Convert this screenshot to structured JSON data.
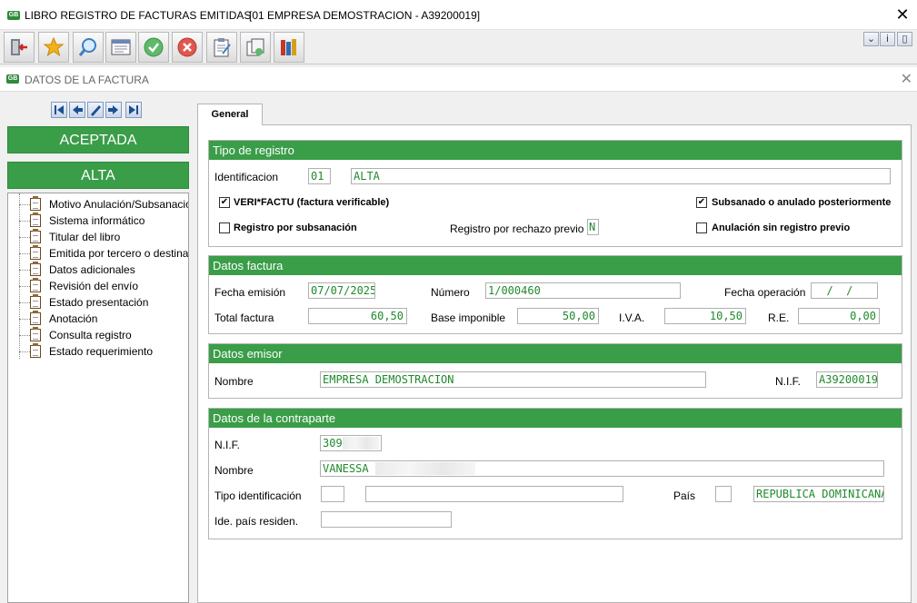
{
  "window": {
    "title": "LIBRO REGISTRO DE FACTURAS EMITIDAS",
    "company": "[01  EMPRESA DEMOSTRACION - A39200019]",
    "close": "✕"
  },
  "toolbar": {
    "buttons": [
      "exit-icon",
      "favorite-star-icon",
      "search-icon",
      "form-view-icon",
      "accept-check-icon",
      "cancel-icon",
      "notes-icon",
      "documents-icon",
      "books-icon"
    ],
    "right": [
      "dropdown-icon",
      "info-icon",
      "scrollbar-icon"
    ]
  },
  "subwindow": {
    "title": "DATOS DE LA FACTURA",
    "close": "✕"
  },
  "status": {
    "first": "ACEPTADA",
    "second": "ALTA"
  },
  "tree": {
    "items": [
      "Motivo Anulación/Subsanación",
      "Sistema informático",
      "Titular del libro",
      "Emitida por tercero o destinatario",
      "Datos adicionales",
      "Revisión del envío",
      "Estado presentación",
      "Anotación",
      "Consulta registro",
      "Estado requerimiento"
    ]
  },
  "tab": {
    "label": "General"
  },
  "tipo_registro": {
    "header": "Tipo de registro",
    "identificacion_label": "Identificacion",
    "identificacion_code": "01",
    "identificacion_value": "ALTA",
    "verifactu_label": "VERI*FACTU (factura verificable)",
    "verifactu_checked": true,
    "subsanado_label": "Subsanado o anulado posteriormente",
    "subsanado_checked": true,
    "registro_subsanacion_label": "Registro por subsanación",
    "registro_subsanacion_checked": false,
    "rechazo_previo_label": "Registro por rechazo previo",
    "rechazo_previo_value": "N",
    "anulacion_label": "Anulación sin registro previo",
    "anulacion_checked": false
  },
  "datos_factura": {
    "header": "Datos factura",
    "fecha_emision_label": "Fecha emisión",
    "fecha_emision": "07/07/2025",
    "numero_label": "Número",
    "numero": "1/000460",
    "fecha_operacion_label": "Fecha operación",
    "fecha_operacion": "  /  /",
    "total_label": "Total factura",
    "total": "60,50",
    "base_label": "Base imponible",
    "base": "50,00",
    "iva_label": "I.V.A.",
    "iva": "10,50",
    "re_label": "R.E.",
    "re": "0,00"
  },
  "datos_emisor": {
    "header": "Datos emisor",
    "nombre_label": "Nombre",
    "nombre": "EMPRESA DEMOSTRACION",
    "nif_label": "N.I.F.",
    "nif": "A39200019"
  },
  "contraparte": {
    "header": "Datos de la contraparte",
    "nif_label": "N.I.F.",
    "nif": "309",
    "nombre_label": "Nombre",
    "nombre": "VANESSA",
    "tipo_id_label": "Tipo identificación",
    "tipo_id_code": "",
    "tipo_id_value": "",
    "pais_label": "País",
    "pais_code": "",
    "pais_value": "REPUBLICA DOMINICANA",
    "ide_pais_label": "Ide. país residen.",
    "ide_pais_value": ""
  },
  "colors": {
    "accent_green": "#3a9d48",
    "field_text_green": "#1f8a2c"
  }
}
